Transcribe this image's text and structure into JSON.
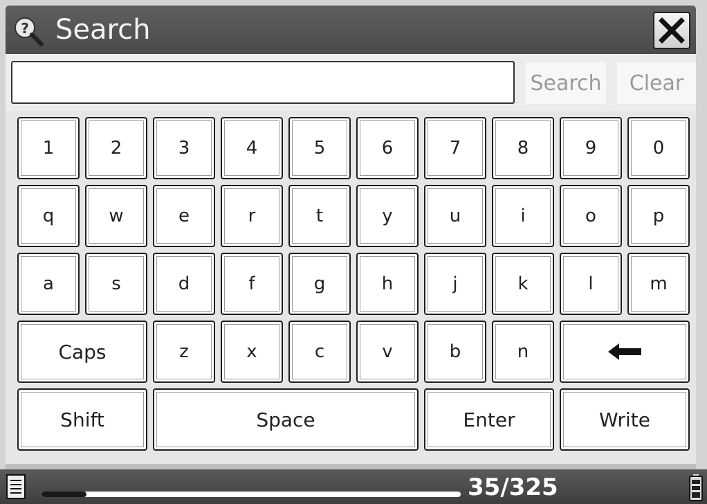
{
  "window": {
    "title": "Search",
    "title_icon": "help-magnifier-icon",
    "close_icon": "close-x-icon"
  },
  "search": {
    "value": "",
    "placeholder": "",
    "search_label": "Search",
    "clear_label": "Clear"
  },
  "keyboard": {
    "row1": [
      "1",
      "2",
      "3",
      "4",
      "5",
      "6",
      "7",
      "8",
      "9",
      "0"
    ],
    "row2": [
      "q",
      "w",
      "e",
      "r",
      "t",
      "y",
      "u",
      "i",
      "o",
      "p"
    ],
    "row3": [
      "a",
      "s",
      "d",
      "f",
      "g",
      "h",
      "j",
      "k",
      "l",
      "m"
    ],
    "row4": {
      "caps": "Caps",
      "letters": [
        "z",
        "x",
        "c",
        "v",
        "b",
        "n"
      ],
      "backspace_icon": "backspace-arrow-icon"
    },
    "row5": {
      "shift": "Shift",
      "space": "Space",
      "enter": "Enter",
      "write": "Write"
    }
  },
  "status": {
    "page_indicator": "35/325",
    "progress_fraction": 0.108,
    "left_icon": "document-icon",
    "right_icon": "battery-icon"
  },
  "colors": {
    "titlebar": "#4f4f4f",
    "statusbar": "#4a4a4a",
    "key_bg": "#ffffff",
    "key_border": "#1e1e1e",
    "disabled_text": "#9a9a9a"
  }
}
